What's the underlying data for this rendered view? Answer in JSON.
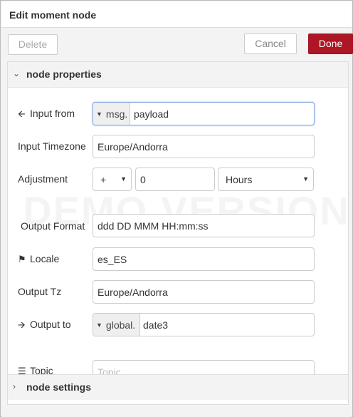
{
  "dialog": {
    "title": "Edit moment node"
  },
  "toolbar": {
    "delete_label": "Delete",
    "cancel_label": "Cancel",
    "done_label": "Done"
  },
  "sections": {
    "properties": {
      "label": "node properties",
      "icon": "chevron-down-icon"
    },
    "settings": {
      "label": "node settings",
      "icon": "chevron-right-icon"
    }
  },
  "watermark": "DEMO VERSION",
  "fields": {
    "input_from": {
      "label": "Input from",
      "icon": "arrow-left-icon",
      "type": "msg.",
      "value": "payload"
    },
    "input_timezone": {
      "label": "Input Timezone",
      "value": "Europe/Andorra"
    },
    "adjustment": {
      "label": "Adjustment",
      "operator": "+",
      "amount": "0",
      "unit": "Hours"
    },
    "output_format": {
      "label": "Output Format",
      "value": "ddd DD MMM HH:mm:ss"
    },
    "locale": {
      "label": "Locale",
      "icon": "flag-icon",
      "value": "es_ES"
    },
    "output_tz": {
      "label": "Output Tz",
      "value": "Europe/Andorra"
    },
    "output_to": {
      "label": "Output to",
      "icon": "arrow-right-icon",
      "type": "global.",
      "value": "date3"
    },
    "topic": {
      "label": "Topic",
      "icon": "list-icon",
      "placeholder": "Topic"
    }
  },
  "colors": {
    "done_button": "#ad1625",
    "focus_border": "#85a8e0"
  }
}
